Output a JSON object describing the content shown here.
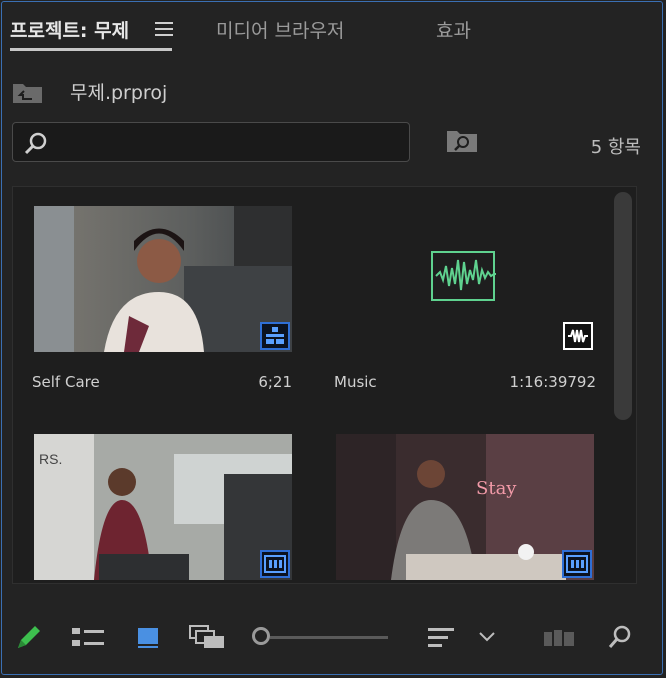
{
  "tabs": [
    {
      "label": "프로젝트: 무제",
      "active": true
    },
    {
      "label": "미디어 브라우저",
      "active": false
    },
    {
      "label": "효과",
      "active": false
    }
  ],
  "project": {
    "name": "무제.prproj"
  },
  "search": {
    "value": "",
    "placeholder": ""
  },
  "item_count": "5 항목",
  "items": [
    {
      "name": "Self Care",
      "duration": "6;21",
      "type": "sequence",
      "badge_icon": "sequence-icon"
    },
    {
      "name": "Music",
      "duration": "1:16:39792",
      "type": "audio",
      "badge_icon": "audio-icon"
    },
    {
      "name": "",
      "duration": "",
      "type": "video",
      "badge_icon": "film-icon"
    },
    {
      "name": "",
      "duration": "",
      "type": "video",
      "badge_icon": "film-icon"
    }
  ],
  "colors": {
    "accent": "#2f6fd6",
    "audio_wave": "#5fd28f",
    "pencil": "#3dbf4e",
    "frame": "#3a6fb3"
  },
  "toolbar": {
    "icons": [
      "pencil-icon",
      "list-view-icon",
      "icon-view-icon",
      "freeform-view-icon",
      "zoom-slider",
      "sort-icon",
      "chevron-down-icon",
      "automate-to-sequence-icon",
      "find-icon"
    ],
    "zoom_level": 0.0
  }
}
